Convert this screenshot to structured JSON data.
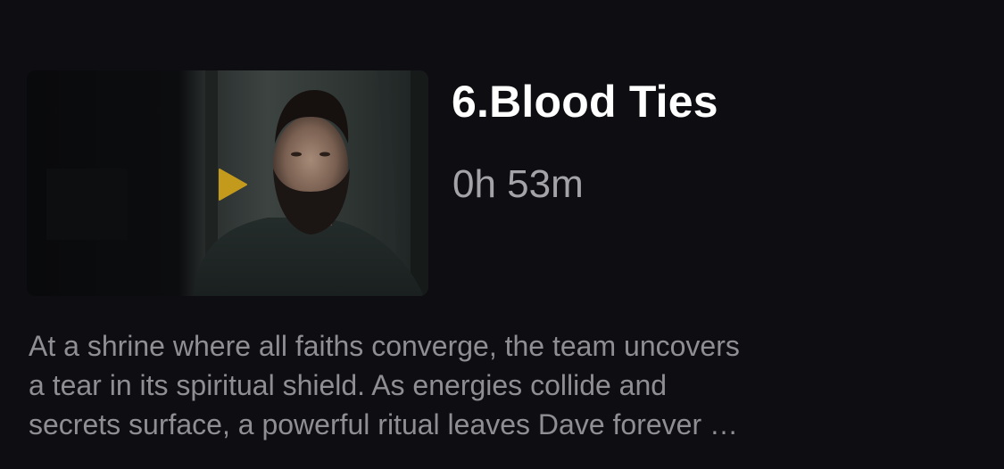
{
  "episode": {
    "thumbnail_alt": "Episode thumbnail",
    "play_icon": "play-icon",
    "play_icon_color": "#c49a1c",
    "title": "6.Blood Ties",
    "duration": "0h 53m",
    "description": "At a shrine where all faiths converge, the team uncovers\na tear in its spiritual shield. As energies collide and\nsecrets surface, a powerful ritual leaves Dave forever …"
  }
}
